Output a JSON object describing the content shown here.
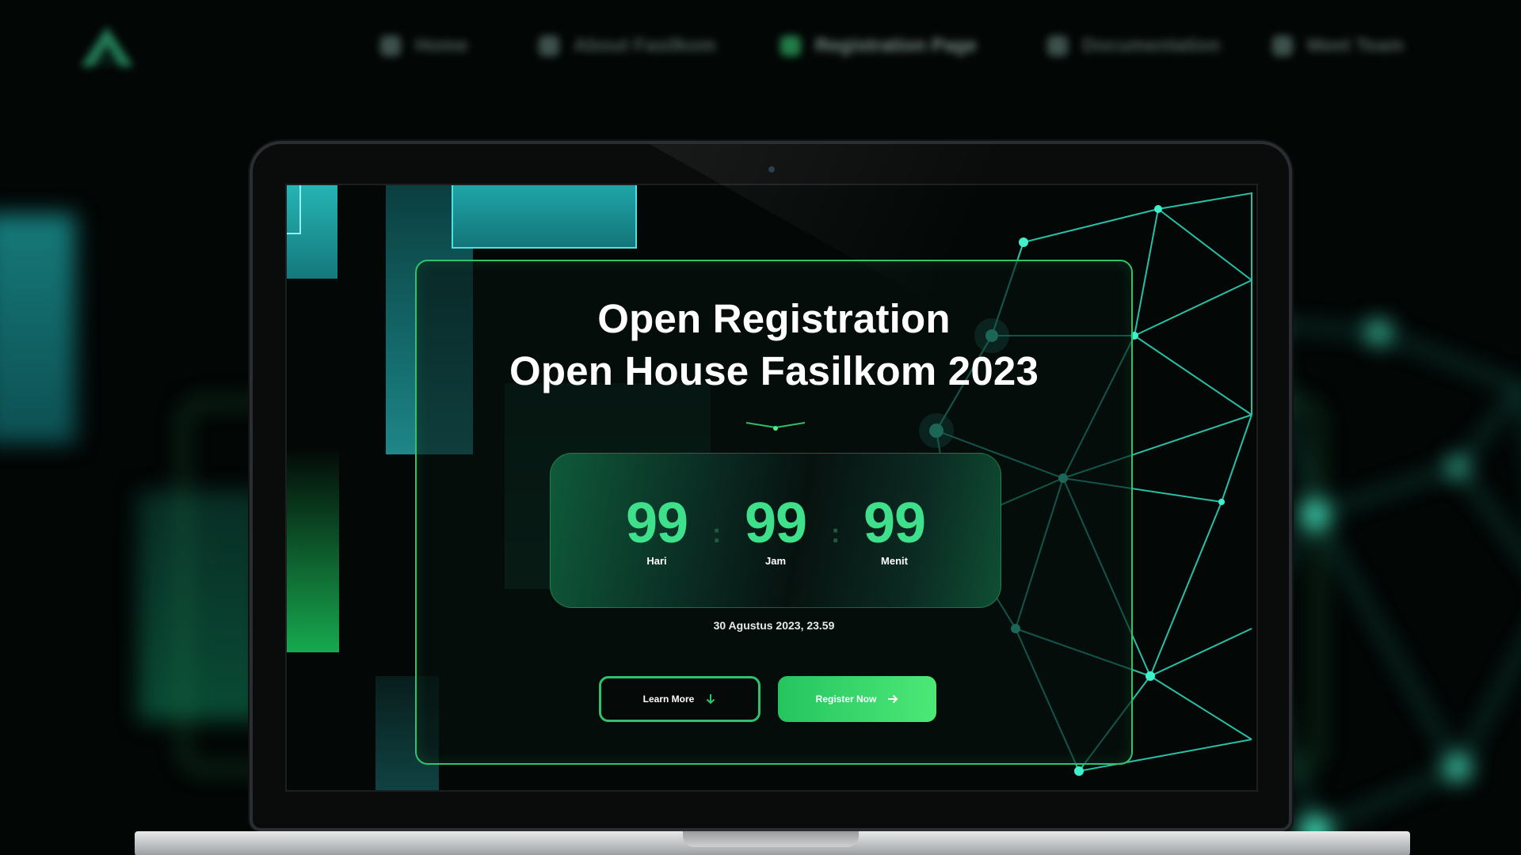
{
  "background_nav": {
    "items": [
      {
        "label": "Home"
      },
      {
        "label": "About Fasilkom"
      },
      {
        "label": "Registration Page",
        "active": true
      },
      {
        "label": "Documentation"
      },
      {
        "label": "Meet Team"
      }
    ]
  },
  "hero": {
    "title_line1": "Open Registration",
    "title_line2": "Open House Fasilkom 2023"
  },
  "countdown": {
    "days": {
      "value": "99",
      "label": "Hari"
    },
    "hours": {
      "value": "99",
      "label": "Jam"
    },
    "minutes": {
      "value": "99",
      "label": "Menit"
    },
    "separator": ":"
  },
  "deadline": "30 Agustus 2023, 23.59",
  "buttons": {
    "learn_more": {
      "label": "Learn More",
      "icon": "arrow-down-icon"
    },
    "register_now": {
      "label": "Register Now",
      "icon": "arrow-right-icon"
    }
  },
  "colors": {
    "accent_green": "#3ee08b",
    "button_green": "#26c460",
    "border_green": "#33c26a",
    "teal": "#1fa5a8",
    "background": "#030706"
  }
}
